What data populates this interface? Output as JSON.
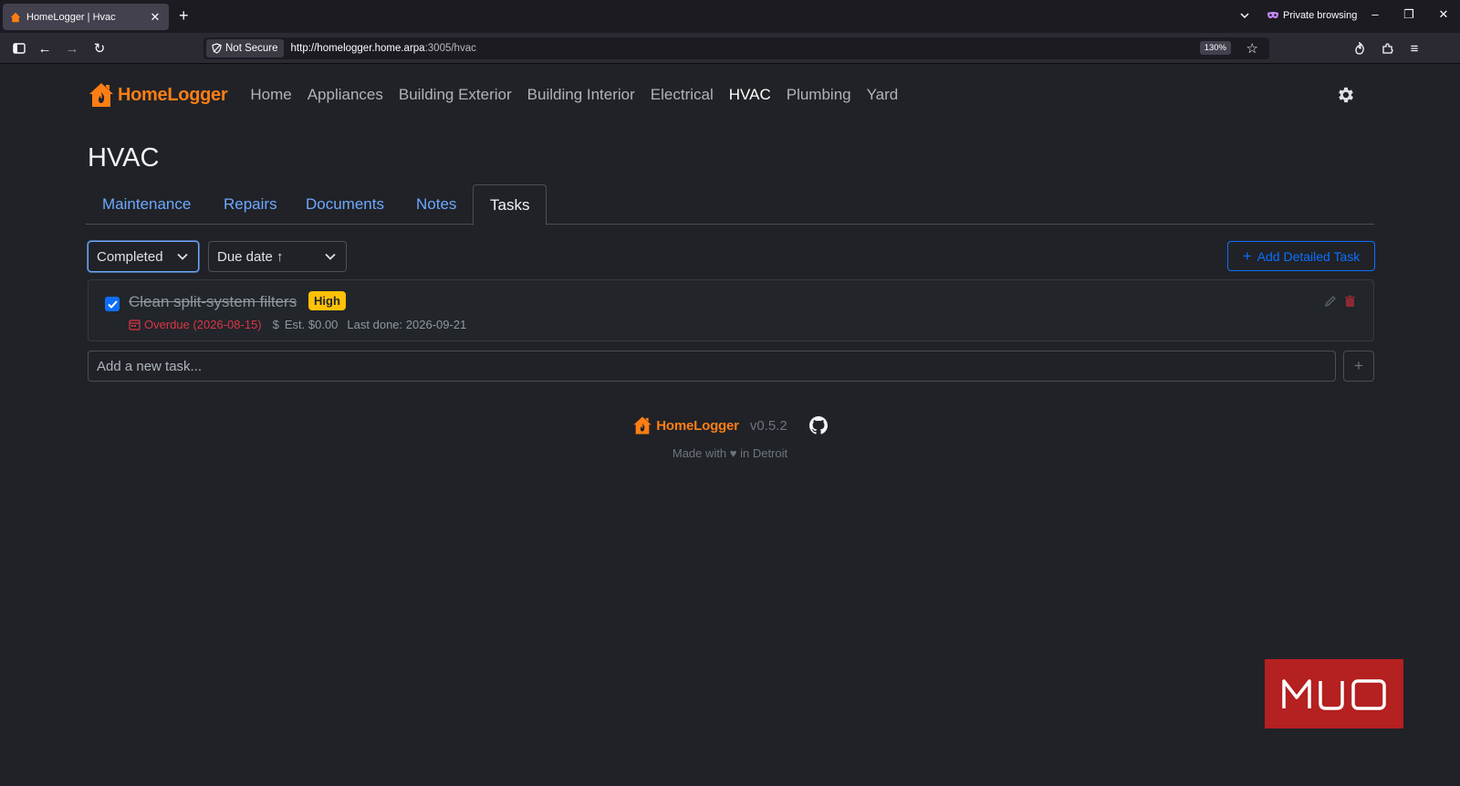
{
  "browser": {
    "tab_title": "HomeLogger | Hvac",
    "private_label": "Private browsing",
    "security_label": "Not Secure",
    "url_host": "http://homelogger.home.arpa",
    "url_rest": ":3005/hvac",
    "zoom": "130%"
  },
  "app": {
    "brand": "HomeLogger",
    "nav": [
      "Home",
      "Appliances",
      "Building Exterior",
      "Building Interior",
      "Electrical",
      "HVAC",
      "Plumbing",
      "Yard"
    ],
    "active_nav": "HVAC",
    "page_title": "HVAC",
    "tabs": [
      "Maintenance",
      "Repairs",
      "Documents",
      "Notes",
      "Tasks"
    ],
    "active_tab": "Tasks",
    "filters": {
      "status_value": "Completed",
      "sort_value": "Due date ↑"
    },
    "add_detailed_label": "Add Detailed Task",
    "task": {
      "title": "Clean split-system filters",
      "priority": "High",
      "completed": true,
      "overdue": "Overdue (2026-08-15)",
      "estimate": "Est. $0.00",
      "last_done": "Last done: 2026-09-21"
    },
    "new_task_placeholder": "Add a new task...",
    "footer": {
      "brand": "HomeLogger",
      "version": "v0.5.2",
      "made_prefix": "Made with",
      "made_suffix": "in Detroit"
    }
  },
  "watermark": "MUO",
  "colors": {
    "accent": "#fd7e14",
    "link": "#6ea8fe",
    "primary": "#0d6efd",
    "danger": "#dc3545",
    "warning": "#ffc107"
  }
}
